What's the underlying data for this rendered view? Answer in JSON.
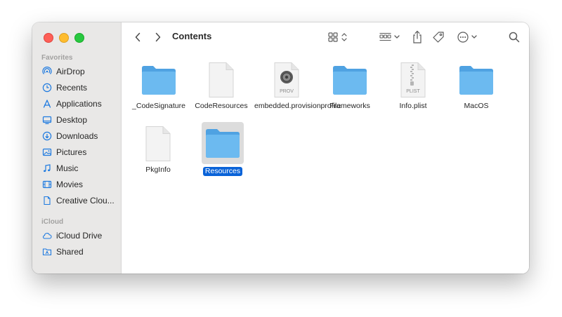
{
  "sidebar": {
    "favorites_header": "Favorites",
    "favorites": [
      {
        "label": "AirDrop",
        "icon": "airdrop-icon"
      },
      {
        "label": "Recents",
        "icon": "clock-icon"
      },
      {
        "label": "Applications",
        "icon": "applications-icon"
      },
      {
        "label": "Desktop",
        "icon": "desktop-icon"
      },
      {
        "label": "Downloads",
        "icon": "download-icon"
      },
      {
        "label": "Pictures",
        "icon": "photo-icon"
      },
      {
        "label": "Music",
        "icon": "music-note-icon"
      },
      {
        "label": "Movies",
        "icon": "film-icon"
      },
      {
        "label": "Creative Clou...",
        "icon": "document-icon"
      }
    ],
    "icloud_header": "iCloud",
    "icloud": [
      {
        "label": "iCloud Drive",
        "icon": "cloud-icon"
      },
      {
        "label": "Shared",
        "icon": "shared-folder-icon"
      }
    ]
  },
  "toolbar": {
    "title": "Contents"
  },
  "files": [
    {
      "name": "_CodeSignature",
      "type": "folder"
    },
    {
      "name": "CodeResources",
      "type": "document"
    },
    {
      "name": "embedded.provisionprofile",
      "type": "prov",
      "badge": "PROV"
    },
    {
      "name": "Frameworks",
      "type": "folder"
    },
    {
      "name": "Info.plist",
      "type": "plist",
      "badge": "PLIST"
    },
    {
      "name": "MacOS",
      "type": "folder"
    },
    {
      "name": "PkgInfo",
      "type": "document"
    },
    {
      "name": "Resources",
      "type": "folder",
      "selected": true
    }
  ],
  "colors": {
    "accent": "#0a63d8",
    "folder": "#5fb3ec",
    "sidebar_icon": "#1e7ae0"
  }
}
